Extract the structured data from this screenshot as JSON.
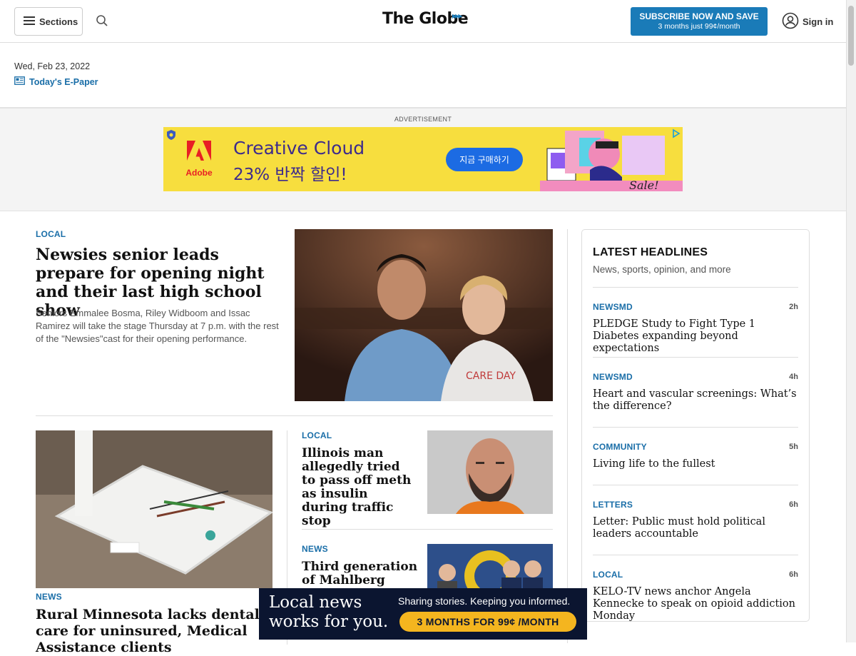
{
  "header": {
    "sections_label": "Sections",
    "logo": "The Globe",
    "subscribe_line1": "SUBSCRIBE NOW AND SAVE",
    "subscribe_line2": "3 months just 99¢/month",
    "signin_label": "Sign in",
    "date": "Wed, Feb 23, 2022",
    "epaper_label": "Today's E-Paper"
  },
  "top_ad": {
    "label": "ADVERTISEMENT",
    "brand": "Adobe",
    "line1": "Creative Cloud",
    "line2": "23% 반짝 할인!",
    "cta": "지금 구매하기"
  },
  "lead_story": {
    "section": "LOCAL",
    "title": "Newsies senior leads prepare for opening night and their last high school show",
    "dek": "Seniors Emmalee Bosma, Riley Widboom and Issac Ramirez will take the stage Thursday at 7 p.m. with the rest of the \"Newsies\"cast for their opening performance."
  },
  "stories": [
    {
      "section": "NEWS",
      "title": "Rural Minnesota lacks dental care for uninsured, Medical Assistance clients"
    },
    {
      "section": "LOCAL",
      "title": "Illinois man allegedly tried to pass off meth as insulin during traffic stop"
    },
    {
      "section": "NEWS",
      "title": "Third generation of Mahlberg family"
    }
  ],
  "latest": {
    "title": "LATEST HEADLINES",
    "subtitle": "News, sports, opinion, and more",
    "items": [
      {
        "section": "NEWSMD",
        "age": "2h",
        "title": "PLEDGE Study to Fight Type 1 Diabetes expanding beyond expectations"
      },
      {
        "section": "NEWSMD",
        "age": "4h",
        "title": "Heart and vascular screenings: What’s the difference?"
      },
      {
        "section": "COMMUNITY",
        "age": "5h",
        "title": "Living life to the fullest"
      },
      {
        "section": "LETTERS",
        "age": "6h",
        "title": "Letter: Public must hold political leaders accountable"
      },
      {
        "section": "LOCAL",
        "age": "6h",
        "title": "KELO-TV news anchor Angela Kennecke to speak on opioid addiction Monday"
      }
    ]
  },
  "bottom_ad": {
    "headline_line1": "Local news",
    "headline_line2": "works for you.",
    "tagline": "Sharing stories. Keeping you informed.",
    "cta": "3 MONTHS FOR 99¢ /MONTH"
  },
  "colors": {
    "accent": "#1a6ea8",
    "subscribe_bg": "#1a7bb8",
    "ad_yellow": "#f7de3e",
    "bottom_ad_bg": "#0b1530",
    "bottom_ad_cta": "#f4b51f"
  }
}
